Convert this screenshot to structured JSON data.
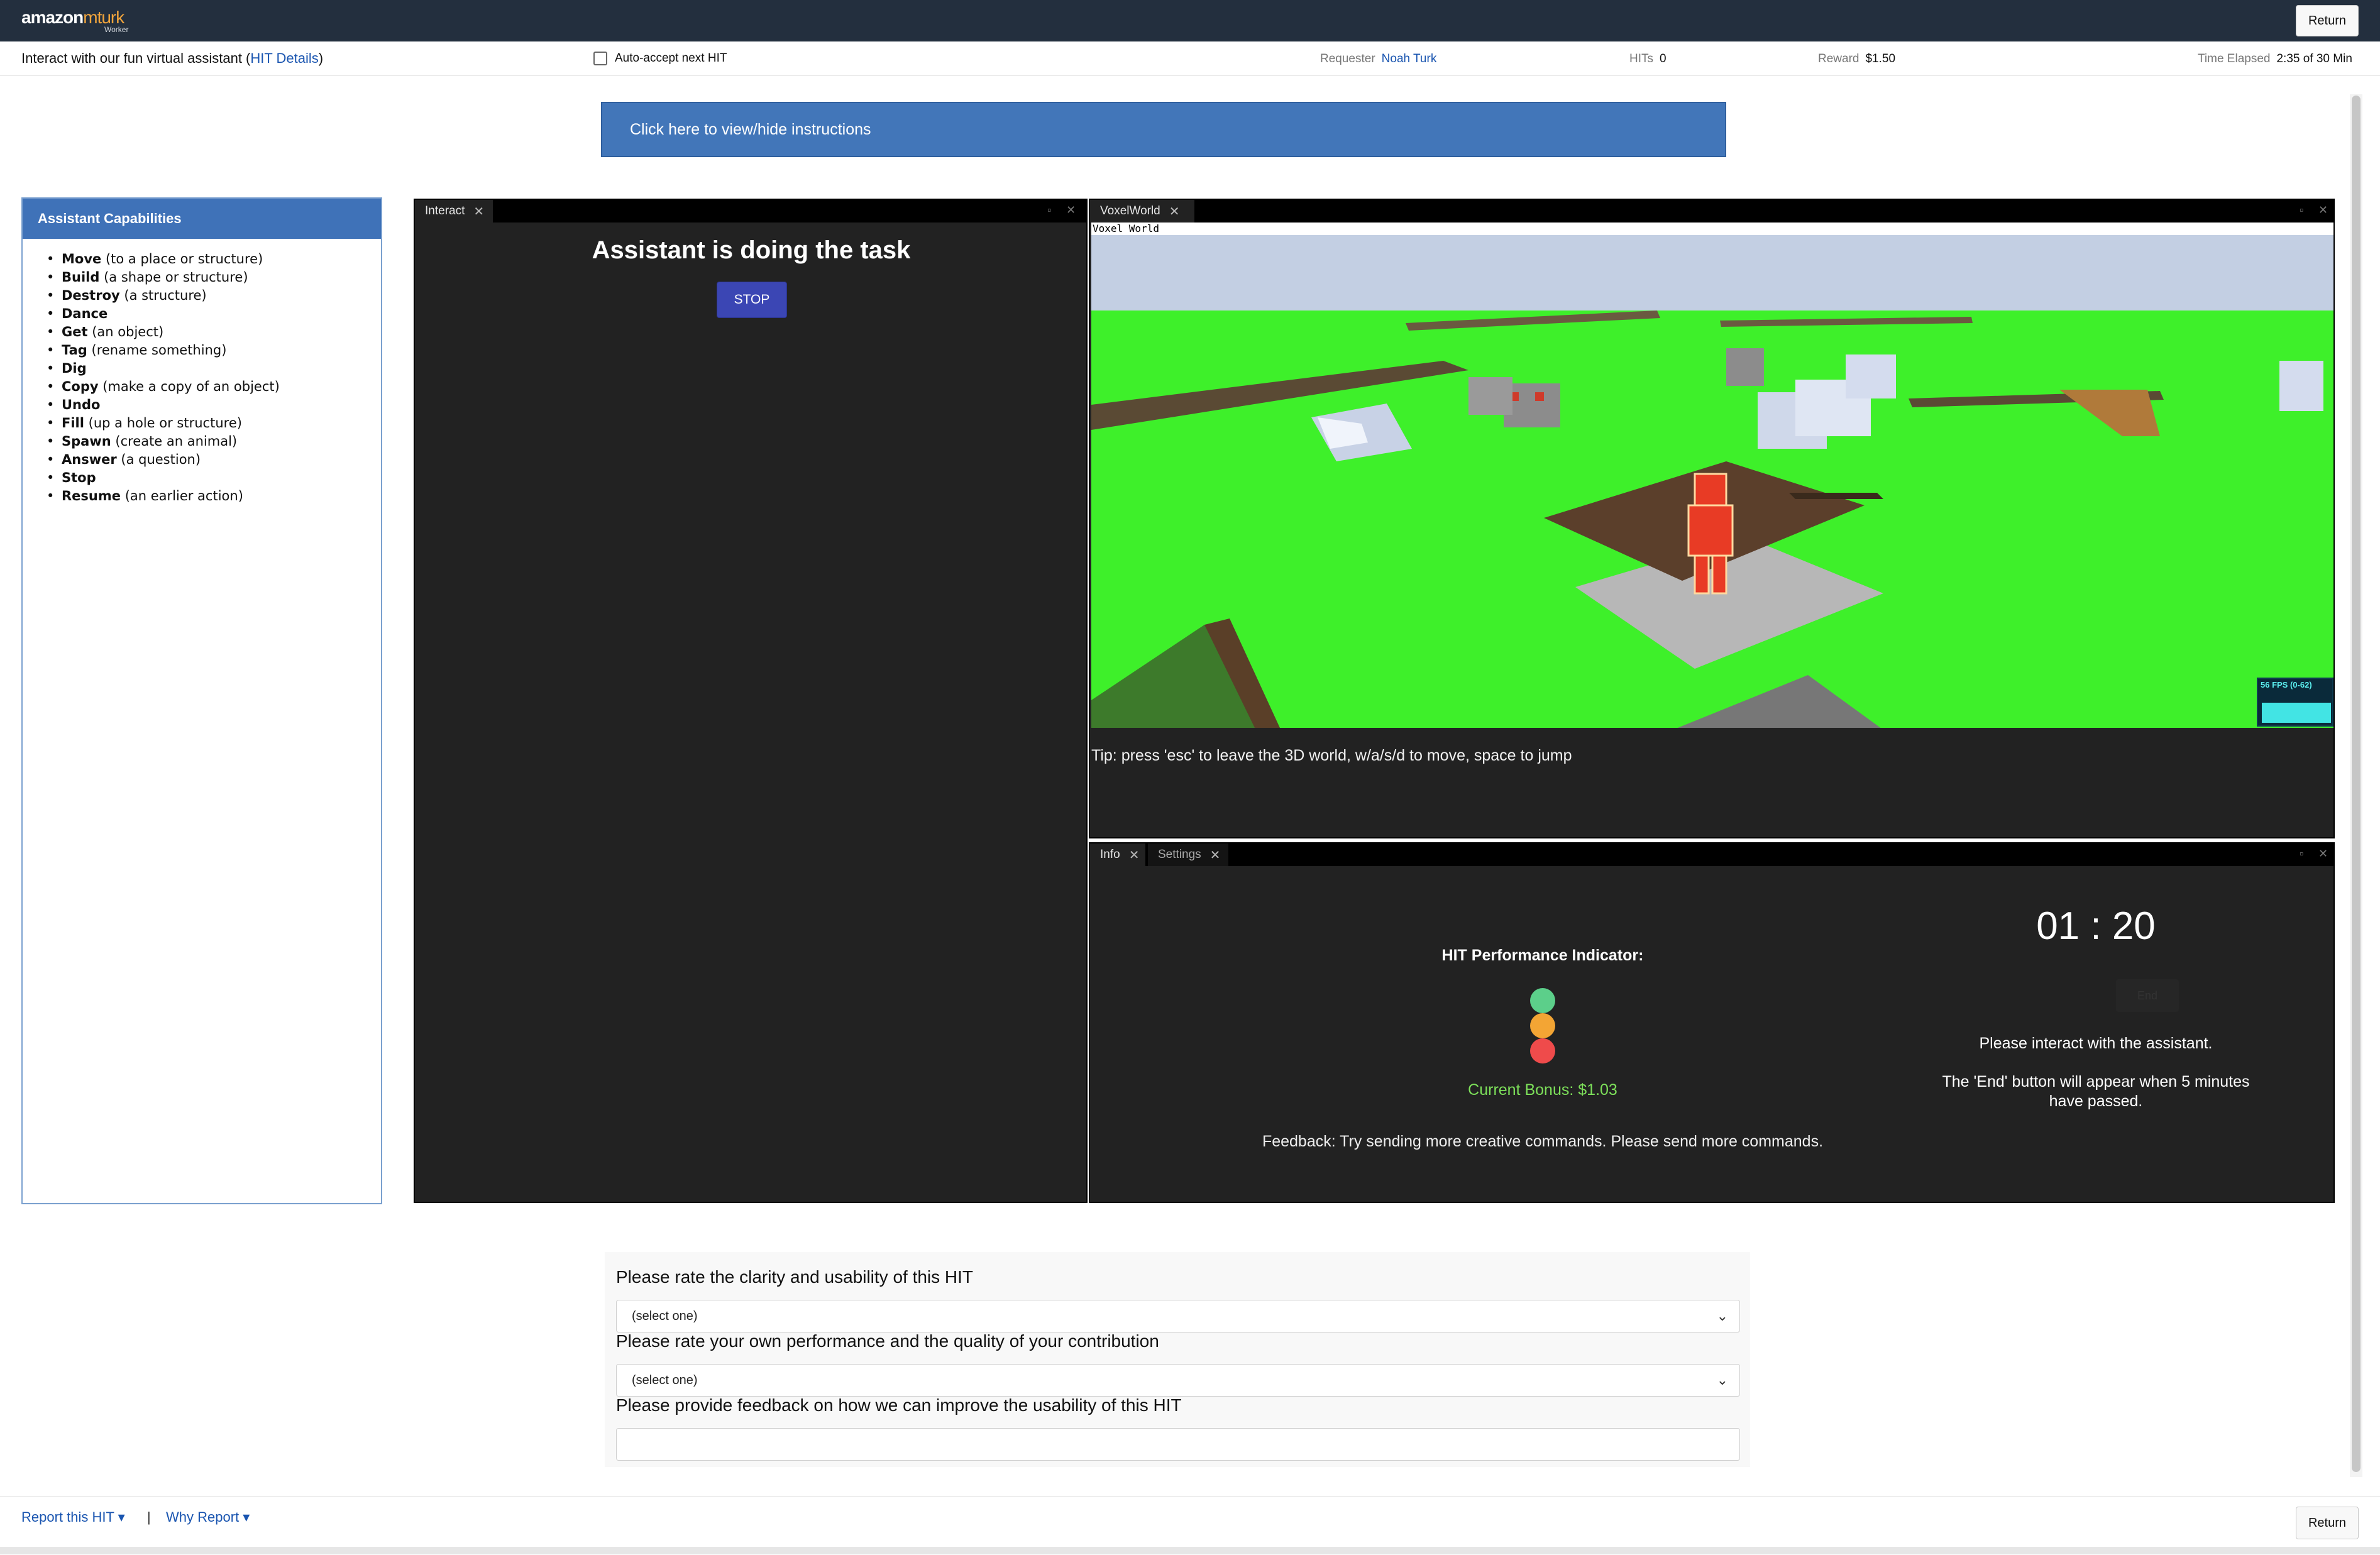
{
  "app": {
    "logo_brand": "amazon",
    "logo_product": "mturk",
    "logo_sub": "Worker",
    "return_label": "Return"
  },
  "infobar": {
    "title_prefix": "Interact with our fun virtual assistant (",
    "title_link": "HIT Details",
    "title_suffix": ")",
    "auto_accept": "Auto-accept next HIT",
    "requester_label": "Requester",
    "requester_value": "Noah Turk",
    "hits_label": "HITs",
    "hits_value": "0",
    "reward_label": "Reward",
    "reward_value": "$1.50",
    "elapsed_label": "Time Elapsed",
    "elapsed_value": "2:35 of 30 Min"
  },
  "instructions_label": "Click here to view/hide instructions",
  "capabilities": {
    "title": "Assistant Capabilities",
    "items": [
      {
        "cmd": "Move",
        "desc": "(to a place or structure)"
      },
      {
        "cmd": "Build",
        "desc": "(a shape or structure)"
      },
      {
        "cmd": "Destroy",
        "desc": "(a structure)"
      },
      {
        "cmd": "Dance",
        "desc": ""
      },
      {
        "cmd": "Get",
        "desc": "(an object)"
      },
      {
        "cmd": "Tag",
        "desc": "(rename something)"
      },
      {
        "cmd": "Dig",
        "desc": ""
      },
      {
        "cmd": "Copy",
        "desc": "(make a copy of an object)"
      },
      {
        "cmd": "Undo",
        "desc": ""
      },
      {
        "cmd": "Fill",
        "desc": "(up a hole or structure)"
      },
      {
        "cmd": "Spawn",
        "desc": "(create an animal)"
      },
      {
        "cmd": "Answer",
        "desc": "(a question)"
      },
      {
        "cmd": "Stop",
        "desc": ""
      },
      {
        "cmd": "Resume",
        "desc": "(an earlier action)"
      }
    ]
  },
  "interact": {
    "tab_label": "Interact",
    "status": "Assistant is doing the task",
    "stop_label": "STOP"
  },
  "voxel": {
    "tab_label": "VoxelWorld",
    "canvas_label": "Voxel World",
    "fps_label": "56 FPS (0-62)",
    "tip": "Tip: press 'esc' to leave the 3D world, w/a/s/d to move, space to jump"
  },
  "info": {
    "tab_info": "Info",
    "tab_settings": "Settings",
    "perf_title": "HIT Performance Indicator:",
    "bonus": "Current Bonus: $1.03",
    "feedback": "Feedback: Try sending more creative commands. Please send more commands.",
    "timer": "01 : 20",
    "end_label": "End",
    "interact_msg": "Please interact with the assistant.",
    "end_note": "The 'End' button will appear when 5 minutes have passed.",
    "lights": [
      "#5ccf8a",
      "#f3a534",
      "#ef4b4b"
    ]
  },
  "survey": {
    "q1": "Please rate the clarity and usability of this HIT",
    "q1_value": "(select one)",
    "q2": "Please rate your own performance and the quality of your contribution",
    "q2_value": "(select one)",
    "q3": "Please provide feedback on how we can improve the usability of this HIT"
  },
  "footer": {
    "report": "Report this HIT ▾",
    "separator": "|",
    "why_report": "Why Report ▾"
  }
}
